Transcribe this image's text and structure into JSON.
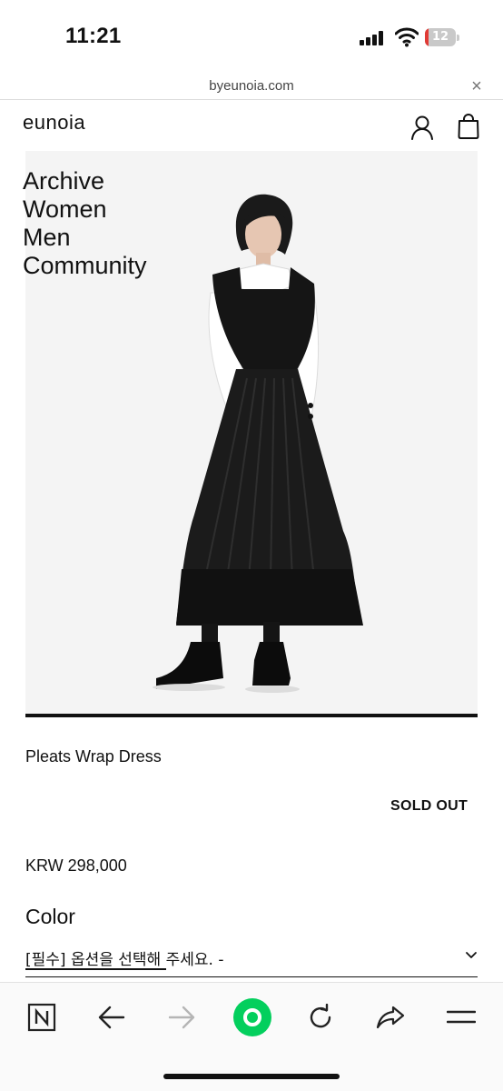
{
  "status": {
    "time": "11:21",
    "battery": "12",
    "battery_level": 0.12,
    "battery_color": "#e03a35"
  },
  "browser": {
    "url": "byeunoia.com",
    "close_glyph": "×"
  },
  "site": {
    "logo": "eunoia",
    "icons": [
      "account-icon",
      "shopping-bag-icon"
    ]
  },
  "menu": {
    "items": [
      "Archive",
      "Women",
      "Men",
      "Community"
    ]
  },
  "hero": {
    "image": "model-wearing-black-pleated-pinafore-dress-over-white-shirt"
  },
  "product": {
    "name": "Pleats Wrap Dress",
    "status": "SOLD OUT",
    "price": "KRW 298,000",
    "option_label": "Color",
    "option_select": "[필수] 옵션을 선택해 주세요. -"
  },
  "toolbar": {
    "icons": [
      "naver-n-icon",
      "back-arrow-icon",
      "forward-arrow-icon",
      "green-home-icon",
      "reload-icon",
      "share-icon",
      "menu-icon"
    ],
    "accent": "#03cf5d"
  }
}
